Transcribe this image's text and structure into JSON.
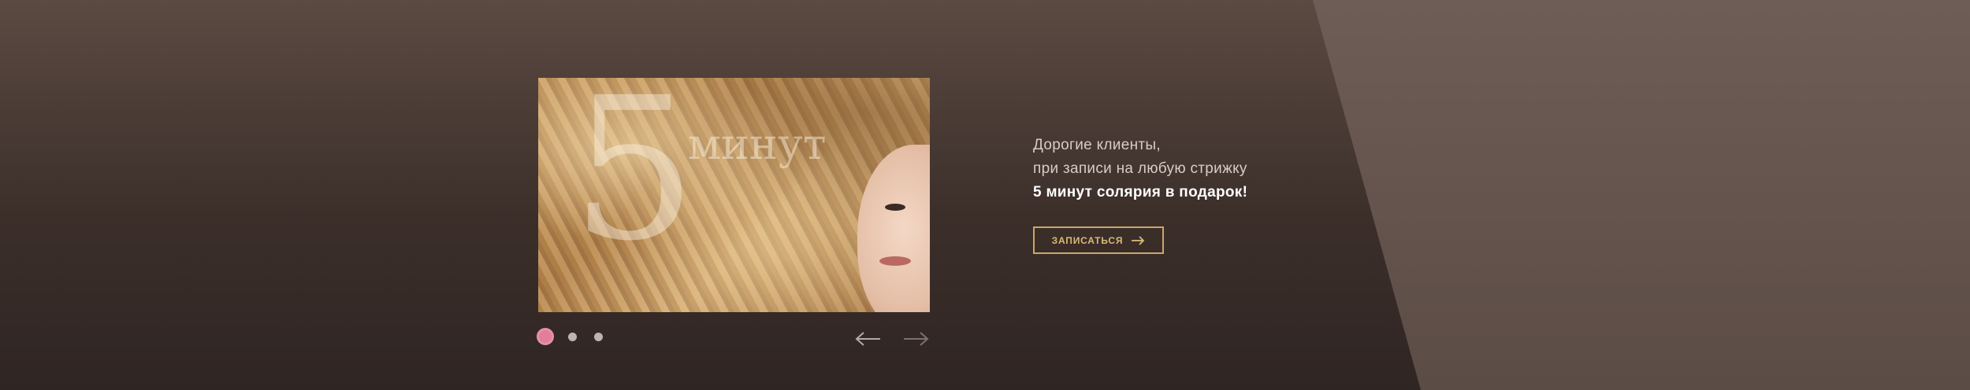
{
  "slider": {
    "slide_number": "5",
    "slide_word": "минут",
    "dots_count": 3,
    "active_dot": 1,
    "active_color": "#e07f97"
  },
  "promo": {
    "line1": "Дорогие клиенты,",
    "line2": "при записи на любую стрижку",
    "line3": "5 минут солярия в подарок!",
    "button_label": "ЗАПИСАТЬСЯ",
    "button_icon": "arrow-right-icon"
  },
  "colors": {
    "background": "#3c2f2a",
    "panel": "#6e5d56",
    "accent": "#c9a86a"
  }
}
